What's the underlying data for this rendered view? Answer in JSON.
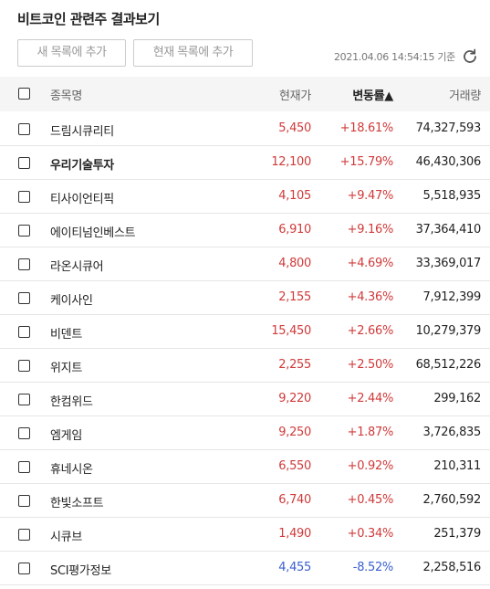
{
  "title": "비트코인 관련주 결과보기",
  "buttons": {
    "add_new": "새 목록에 추가",
    "add_current": "현재 목록에 추가"
  },
  "timestamp": "2021.04.06 14:54:15 기준",
  "header": {
    "name": "종목명",
    "price": "현재가",
    "change": "변동률▲",
    "volume": "거래량"
  },
  "colors": {
    "up": "#d03a3a",
    "down": "#3a5fd0"
  },
  "rows": [
    {
      "name": "드림시큐리티",
      "price": "5,450",
      "change": "+18.61%",
      "volume": "74,327,593",
      "dir": "up",
      "bold": false
    },
    {
      "name": "우리기술투자",
      "price": "12,100",
      "change": "+15.79%",
      "volume": "46,430,306",
      "dir": "up",
      "bold": true
    },
    {
      "name": "티사이언티픽",
      "price": "4,105",
      "change": "+9.47%",
      "volume": "5,518,935",
      "dir": "up",
      "bold": false
    },
    {
      "name": "에이티넘인베스트",
      "price": "6,910",
      "change": "+9.16%",
      "volume": "37,364,410",
      "dir": "up",
      "bold": false
    },
    {
      "name": "라온시큐어",
      "price": "4,800",
      "change": "+4.69%",
      "volume": "33,369,017",
      "dir": "up",
      "bold": false
    },
    {
      "name": "케이사인",
      "price": "2,155",
      "change": "+4.36%",
      "volume": "7,912,399",
      "dir": "up",
      "bold": false
    },
    {
      "name": "비덴트",
      "price": "15,450",
      "change": "+2.66%",
      "volume": "10,279,379",
      "dir": "up",
      "bold": false
    },
    {
      "name": "위지트",
      "price": "2,255",
      "change": "+2.50%",
      "volume": "68,512,226",
      "dir": "up",
      "bold": false
    },
    {
      "name": "한컴위드",
      "price": "9,220",
      "change": "+2.44%",
      "volume": "299,162",
      "dir": "up",
      "bold": false
    },
    {
      "name": "엠게임",
      "price": "9,250",
      "change": "+1.87%",
      "volume": "3,726,835",
      "dir": "up",
      "bold": false
    },
    {
      "name": "휴네시온",
      "price": "6,550",
      "change": "+0.92%",
      "volume": "210,311",
      "dir": "up",
      "bold": false
    },
    {
      "name": "한빛소프트",
      "price": "6,740",
      "change": "+0.45%",
      "volume": "2,760,592",
      "dir": "up",
      "bold": false
    },
    {
      "name": "시큐브",
      "price": "1,490",
      "change": "+0.34%",
      "volume": "251,379",
      "dir": "up",
      "bold": false
    },
    {
      "name": "SCI평가정보",
      "price": "4,455",
      "change": "-8.52%",
      "volume": "2,258,516",
      "dir": "down",
      "bold": false
    }
  ]
}
